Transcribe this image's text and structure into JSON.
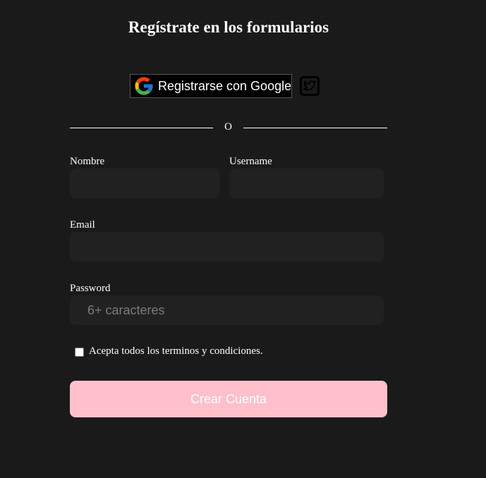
{
  "form": {
    "title": "Regístrate en los formularios",
    "google_button": {
      "label": "Registrarse con Google",
      "icon": "google-g-icon"
    },
    "twitter_button": {
      "icon": "twitter-bird-icon"
    },
    "divider_text": "O",
    "fields": {
      "nombre": {
        "label": "Nombre",
        "value": "",
        "placeholder": ""
      },
      "username": {
        "label": "Username",
        "value": "",
        "placeholder": ""
      },
      "email": {
        "label": "Email",
        "value": "",
        "placeholder": ""
      },
      "password": {
        "label": "Password",
        "value": "",
        "placeholder": "6+ caracteres"
      }
    },
    "terms": {
      "label": "Acepta todos los terminos y condiciones.",
      "checked": false
    },
    "submit_label": "Crear Cuenta"
  },
  "colors": {
    "background": "#1a1a1a",
    "input_background": "#212121",
    "submit_background": "#ffc0cb",
    "text": "#ffffff"
  }
}
